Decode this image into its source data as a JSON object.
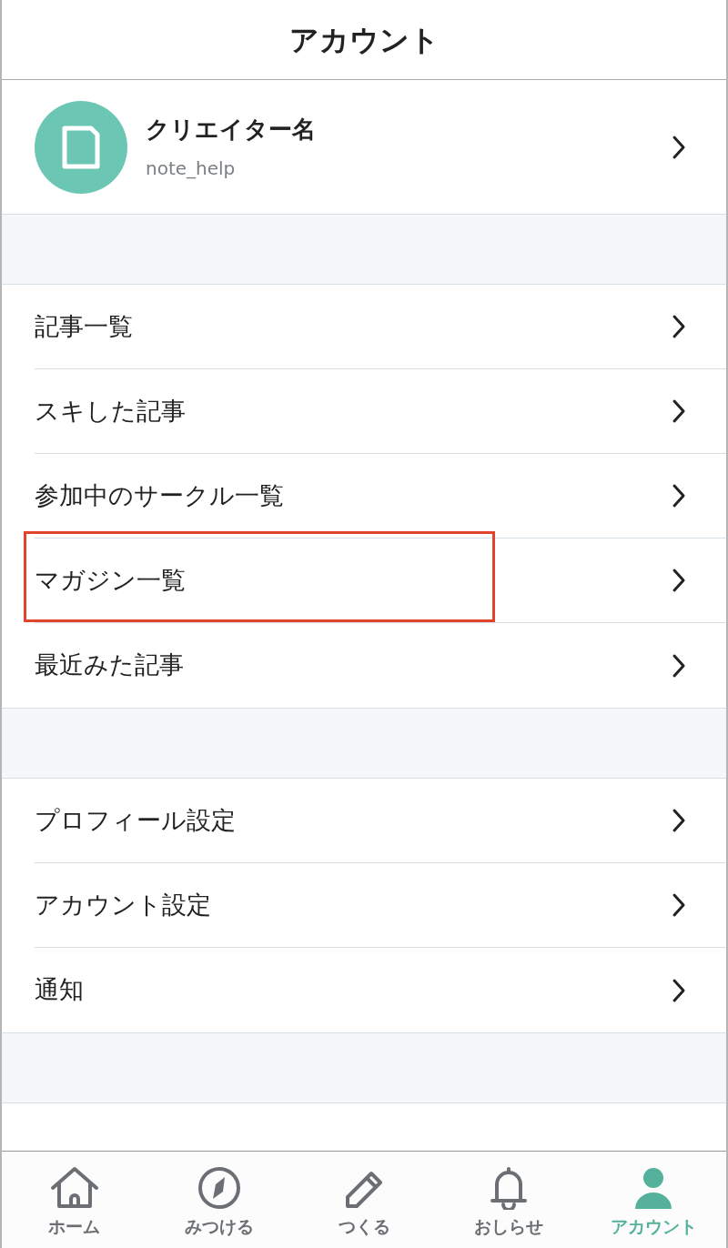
{
  "header": {
    "title": "アカウント"
  },
  "profile": {
    "name": "クリエイター名",
    "handle": "note_help"
  },
  "sections": [
    {
      "items": [
        {
          "label": "記事一覧",
          "highlighted": false
        },
        {
          "label": "スキした記事",
          "highlighted": false
        },
        {
          "label": "参加中のサークル一覧",
          "highlighted": false
        },
        {
          "label": "マガジン一覧",
          "highlighted": true
        },
        {
          "label": "最近みた記事",
          "highlighted": false
        }
      ]
    },
    {
      "items": [
        {
          "label": "プロフィール設定",
          "highlighted": false
        },
        {
          "label": "アカウント設定",
          "highlighted": false
        },
        {
          "label": "通知",
          "highlighted": false
        }
      ]
    }
  ],
  "tab_bar": [
    {
      "kind": "home",
      "label": "ホーム",
      "selected": false
    },
    {
      "kind": "discover",
      "label": "みつける",
      "selected": false
    },
    {
      "kind": "create",
      "label": "つくる",
      "selected": false
    },
    {
      "kind": "notifications",
      "label": "おしらせ",
      "selected": false
    },
    {
      "kind": "account",
      "label": "アカウント",
      "selected": true
    }
  ]
}
